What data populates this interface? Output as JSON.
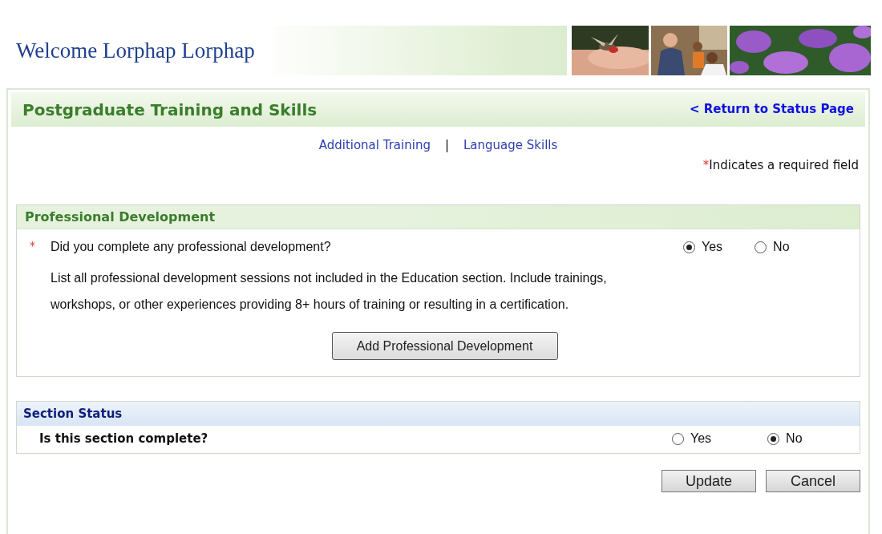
{
  "header": {
    "welcome": "Welcome Lorphap Lorphap"
  },
  "page": {
    "title": "Postgraduate Training and Skills",
    "return_link": "< Return to Status Page"
  },
  "subnav": {
    "links": [
      "Additional Training",
      "Language Skills"
    ],
    "separator": "|"
  },
  "required_note": {
    "mark": "*",
    "text": "Indicates a required field"
  },
  "professional_development": {
    "heading": "Professional Development",
    "question": {
      "mark": "*",
      "text": "Did you complete any professional development?",
      "options": [
        {
          "label": "Yes",
          "selected": true
        },
        {
          "label": "No",
          "selected": false
        }
      ]
    },
    "instructions": "List all professional development sessions not included in the Education section. Include trainings, workshops, or other experiences providing 8+ hours of training or resulting in a certification.",
    "add_button": "Add Professional Development"
  },
  "section_status": {
    "heading": "Section Status",
    "question": "Is this section complete?",
    "options": [
      {
        "label": "Yes",
        "selected": false
      },
      {
        "label": "No",
        "selected": true
      }
    ]
  },
  "buttons": [
    "Update",
    "Cancel"
  ]
}
